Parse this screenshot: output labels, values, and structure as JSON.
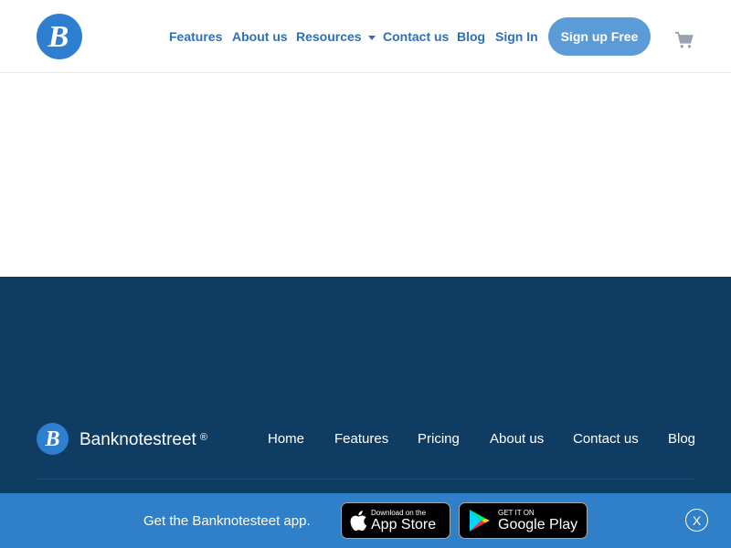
{
  "header": {
    "logo_letter": "B",
    "nav": {
      "features": "Features",
      "about": "About us",
      "resources": "Resources",
      "contact": "Contact us",
      "blog": "Blog",
      "signin": "Sign In"
    },
    "signup_label": "Sign up Free",
    "cart_icon": "shopping-cart-icon"
  },
  "footer": {
    "logo_letter": "B",
    "brand": "Banknotestreet",
    "brand_mark": "®",
    "links": {
      "home": "Home",
      "features": "Features",
      "pricing": "Pricing",
      "about": "About us",
      "contact": "Contact us",
      "blog": "Blog"
    }
  },
  "app_banner": {
    "text": "Get the Banknotesteet app.",
    "app_store_small": "Download on the",
    "app_store_big": "App Store",
    "google_play_small": "GET IT ON",
    "google_play_big": "Google Play",
    "close_label": "X"
  },
  "colors": {
    "accent": "#2f7fd0",
    "nav_text": "#2f6fb5",
    "signup_bg": "#5b9bd8",
    "footer_bg": "#0f3c63",
    "banner_bg": "#2f80c9"
  }
}
